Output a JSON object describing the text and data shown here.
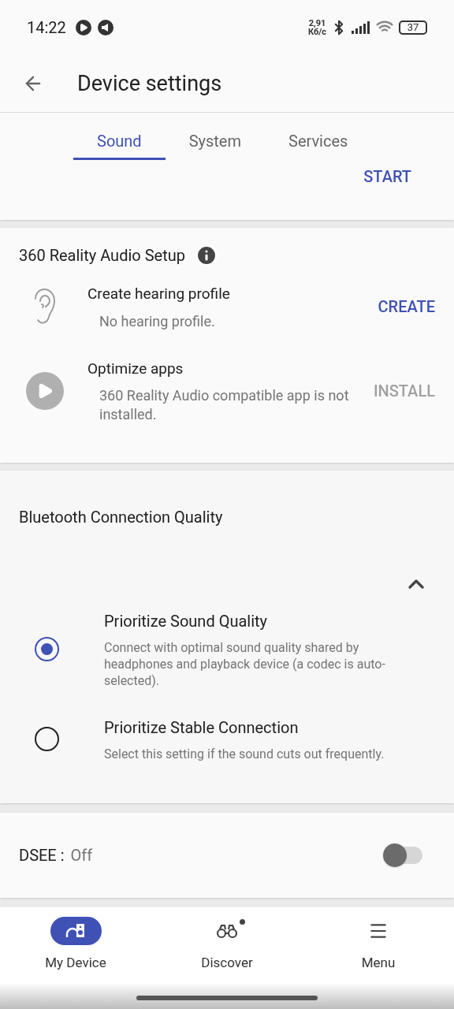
{
  "status_bar": {
    "time": "14:22",
    "speed_value": "2,91",
    "speed_unit": "Кб/с",
    "battery": "37"
  },
  "header": {
    "title": "Device settings"
  },
  "tabs": [
    {
      "label": "Sound",
      "selected": true
    },
    {
      "label": "System",
      "selected": false
    },
    {
      "label": "Services",
      "selected": false
    }
  ],
  "start_button": "START",
  "reality_audio": {
    "title": "360 Reality Audio Setup",
    "items": [
      {
        "kind": "ear",
        "title": "Create hearing profile",
        "description": "No hearing profile.",
        "action": "CREATE",
        "disabled": false
      },
      {
        "kind": "play",
        "title": "Optimize apps",
        "description": "360 Reality Audio compatible app is not installed.",
        "action": "INSTALL",
        "disabled": true
      }
    ]
  },
  "bluetooth": {
    "title": "Bluetooth Connection Quality",
    "expanded": true,
    "options": [
      {
        "title": "Prioritize Sound Quality",
        "description": "Connect with optimal sound quality shared by headphones and playback device (a codec is auto-selected).",
        "selected": true
      },
      {
        "title": "Prioritize Stable Connection",
        "description": "Select this setting if the sound cuts out frequently.",
        "selected": false
      }
    ]
  },
  "dsee": {
    "label": "DSEE :",
    "value": "Off",
    "on": false
  },
  "bottom_nav": [
    {
      "kind": "device",
      "label": "My Device",
      "selected": true,
      "badge": false
    },
    {
      "kind": "discover",
      "label": "Discover",
      "selected": false,
      "badge": true
    },
    {
      "kind": "menu",
      "label": "Menu",
      "selected": false,
      "badge": false
    }
  ]
}
